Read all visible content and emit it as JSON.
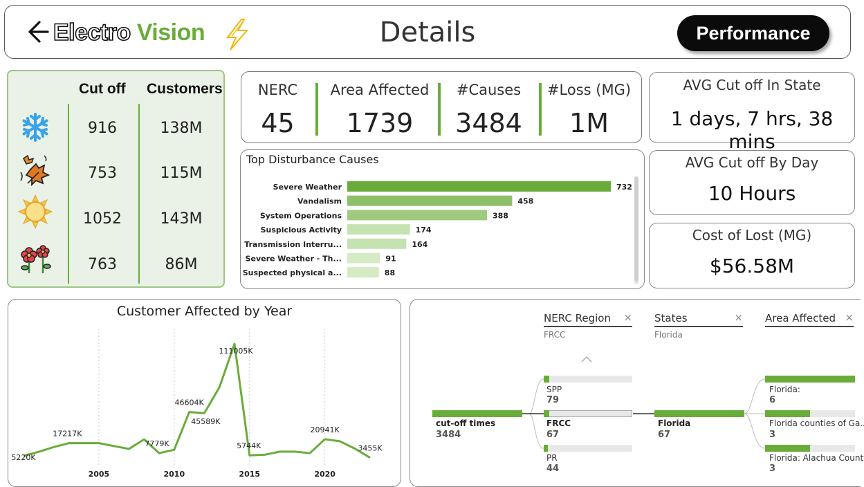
{
  "header": {
    "logo_part1": "Electro",
    "logo_part2": "Vision",
    "title": "Details",
    "performance_button": "Performance"
  },
  "seasons": {
    "col_cutoff": "Cut off",
    "col_customers": "Customers",
    "rows": [
      {
        "icon": "snowflake-icon",
        "cutoff": "916",
        "customers": "138M"
      },
      {
        "icon": "autumn-leaves-icon",
        "cutoff": "753",
        "customers": "115M"
      },
      {
        "icon": "sun-icon",
        "cutoff": "1052",
        "customers": "143M"
      },
      {
        "icon": "spring-flowers-icon",
        "cutoff": "763",
        "customers": "86M"
      }
    ]
  },
  "kpis": [
    {
      "label": "NERC",
      "value": "45"
    },
    {
      "label": "Area Affected",
      "value": "1739"
    },
    {
      "label": "#Causes",
      "value": "3484"
    },
    {
      "label": "#Loss (MG)",
      "value": "1M"
    }
  ],
  "side_cards": {
    "avg_state": {
      "label": "AVG Cut off In State",
      "value": "1 days, 7 hrs, 38 mins"
    },
    "avg_day": {
      "label": "AVG Cut off By Day",
      "value": "10 Hours"
    },
    "cost": {
      "label": "Cost of Lost (MG)",
      "value": "$56.58M"
    }
  },
  "colors": {
    "accent": "#6aac3a",
    "accent_light": "#c5e3b0",
    "dark": "#0b0b0b"
  },
  "chart_data": [
    {
      "type": "bar",
      "orientation": "horizontal",
      "title": "Top Disturbance Causes",
      "categories": [
        "Severe Weather",
        "Vandalism",
        "System Operations",
        "Suspicious Activity",
        "Transmission Interru...",
        "Severe Weather - Th...",
        "Suspected physical a..."
      ],
      "values": [
        732,
        458,
        388,
        174,
        164,
        91,
        88
      ],
      "xlim": [
        0,
        732
      ]
    },
    {
      "type": "line",
      "title": "Customer Affected by Year",
      "xlabel": "",
      "ylabel": "",
      "x_ticks": [
        "2005",
        "2010",
        "2015",
        "2020"
      ],
      "x": [
        2000,
        2001,
        2002,
        2003,
        2004,
        2005,
        2006,
        2007,
        2008,
        2009,
        2010,
        2011,
        2012,
        2013,
        2014,
        2015,
        2016,
        2017,
        2018,
        2019,
        2020,
        2021,
        2022,
        2023
      ],
      "values": [
        5220,
        9000,
        13500,
        17217,
        17217,
        17217,
        14500,
        11800,
        20800,
        7779,
        11000,
        46604,
        45589,
        70000,
        111005,
        5744,
        6300,
        9200,
        9200,
        7800,
        20941,
        19000,
        12000,
        3455
      ],
      "data_labels": [
        {
          "x": 2000,
          "label": "5220K"
        },
        {
          "x": 2003,
          "label": "17217K"
        },
        {
          "x": 2009,
          "label": "7779K"
        },
        {
          "x": 2011,
          "label": "46604K"
        },
        {
          "x": 2012,
          "label": "45589K"
        },
        {
          "x": 2014,
          "label": "111005K"
        },
        {
          "x": 2015,
          "label": "5744K"
        },
        {
          "x": 2020,
          "label": "20941K"
        },
        {
          "x": 2023,
          "label": "3455K"
        }
      ],
      "ylim": [
        0,
        115000
      ],
      "grid": "vertical"
    }
  ],
  "decomposition": {
    "levels": [
      {
        "header": "NERC Region",
        "selected": "FRCC"
      },
      {
        "header": "States",
        "selected": "Florida"
      },
      {
        "header": "Area Affected",
        "selected": ""
      }
    ],
    "root": {
      "label": "cut-off times",
      "value": "3484"
    },
    "nerc_items": [
      {
        "label": "SPP",
        "value": "79",
        "fraction": 0.06
      },
      {
        "label": "FRCC",
        "value": "67",
        "fraction": 0.06
      },
      {
        "label": "PR",
        "value": "44",
        "fraction": 0.04
      }
    ],
    "state_item": {
      "label": "Florida",
      "value": "67"
    },
    "area_items": [
      {
        "label": "Florida:",
        "value": "6",
        "fraction": 1.0
      },
      {
        "label": "Florida counties of Ga...",
        "value": "3",
        "fraction": 0.5
      },
      {
        "label": "Florida: Alachua County",
        "value": "3",
        "fraction": 0.5
      }
    ]
  }
}
